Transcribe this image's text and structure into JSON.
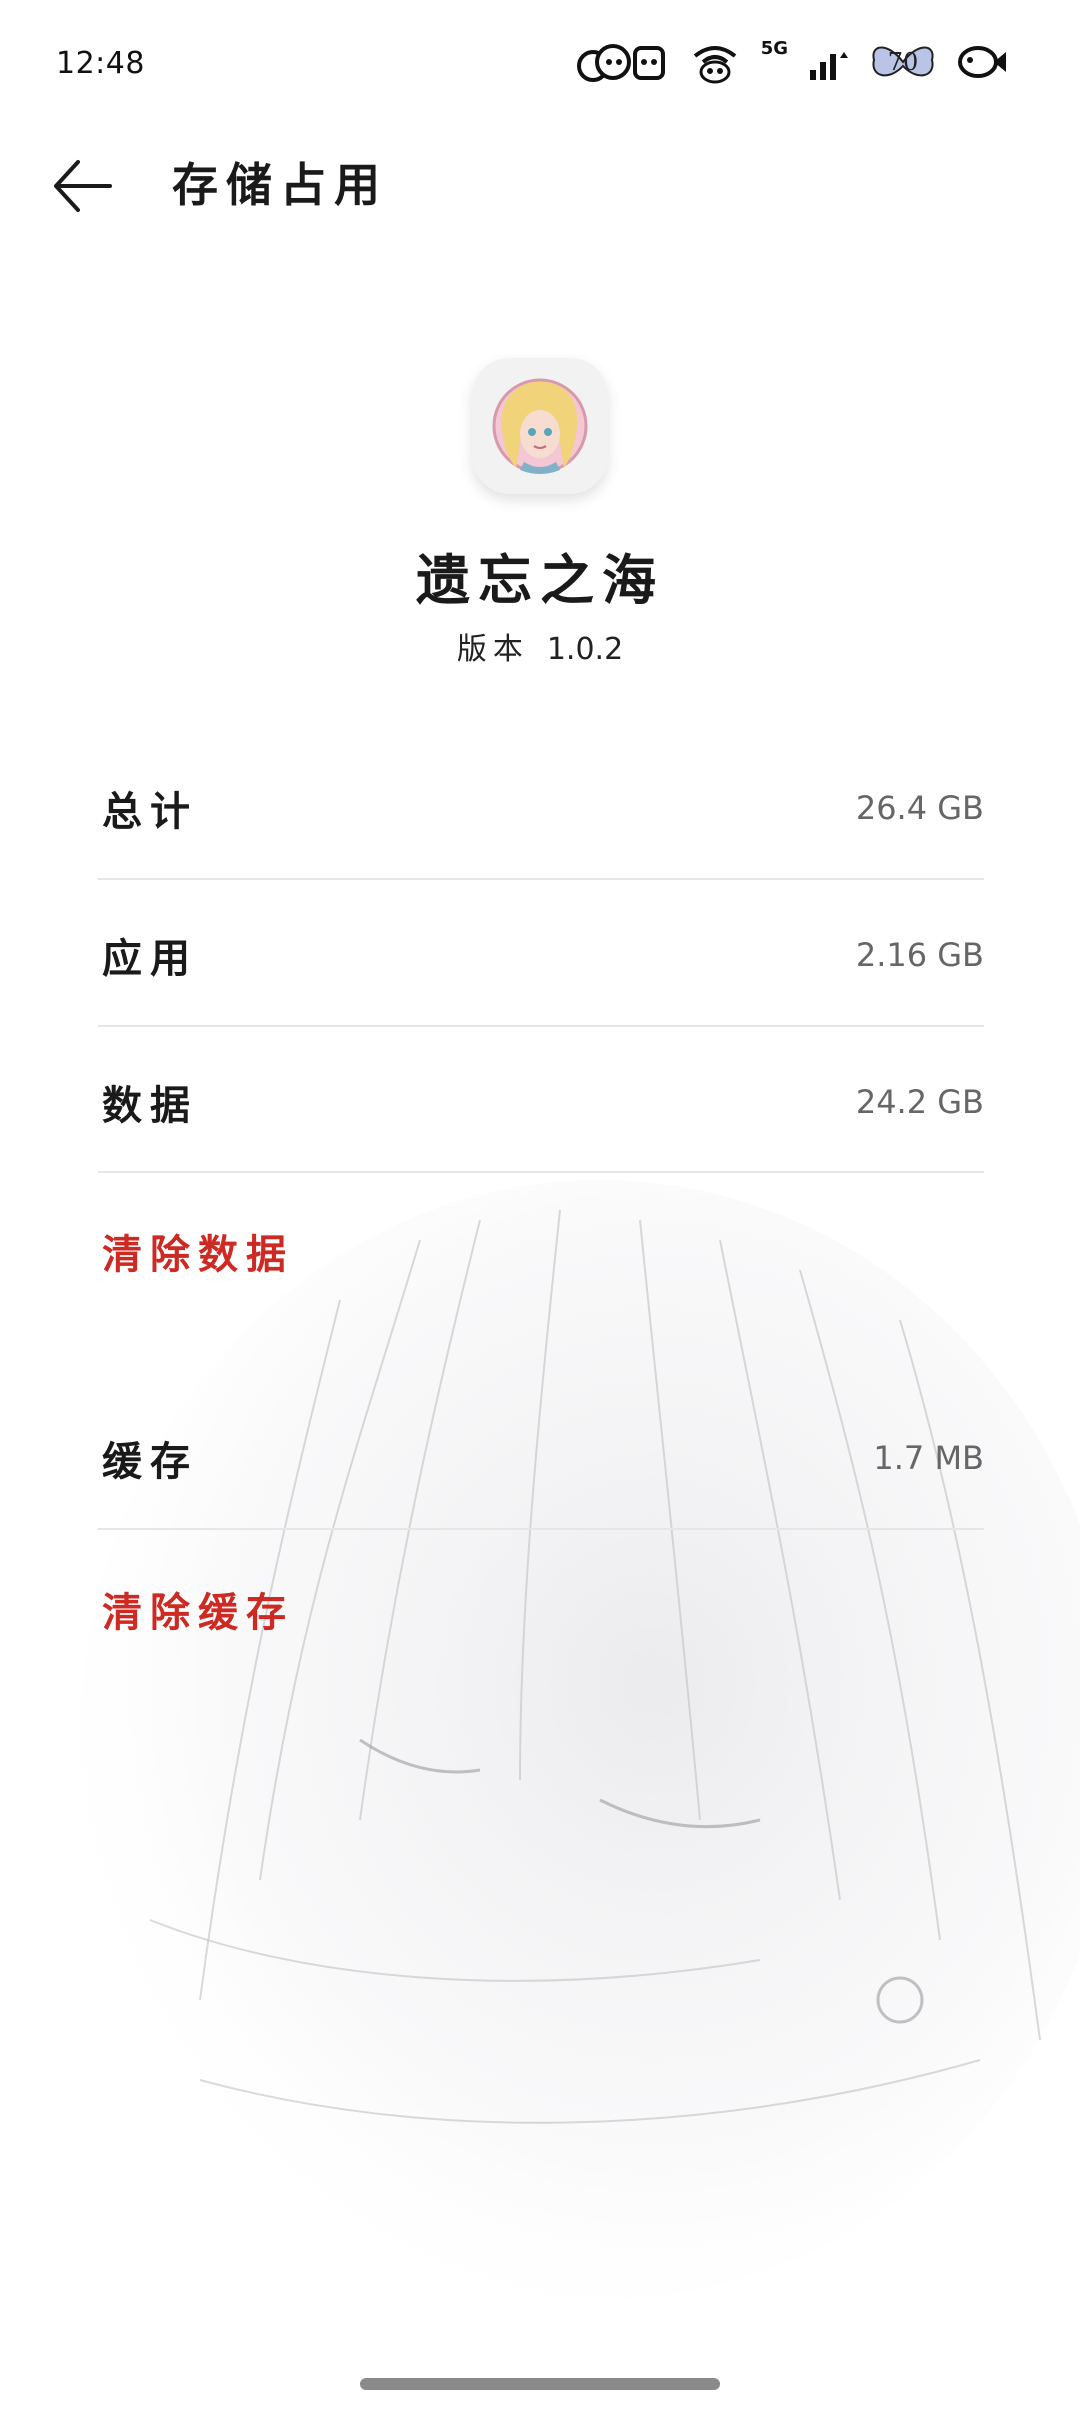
{
  "status_bar": {
    "time": "12:48",
    "network_label": "5G",
    "battery_level": "70",
    "icons": [
      "cloud-bear-icon",
      "cat-icon",
      "wifi-panda-icon",
      "signal-icon",
      "battery-butterfly-icon",
      "fish-icon"
    ]
  },
  "app_bar": {
    "title": "存储占用",
    "back_icon": "arrow-left-icon"
  },
  "app": {
    "name": "遗忘之海",
    "version_label": "版本",
    "version": "1.0.2",
    "icon": "doll-avatar-icon"
  },
  "storage": {
    "total_label": "总计",
    "total_value": "26.4 GB",
    "app_label": "应用",
    "app_value": "2.16 GB",
    "data_label": "数据",
    "data_value": "24.2 GB",
    "clear_data": "清除数据",
    "cache_label": "缓存",
    "cache_value": "1.7 MB",
    "clear_cache": "清除缓存"
  },
  "colors": {
    "accent_red": "#cc2a22",
    "value_gray": "#666666",
    "divider": "#e6e6e6"
  }
}
